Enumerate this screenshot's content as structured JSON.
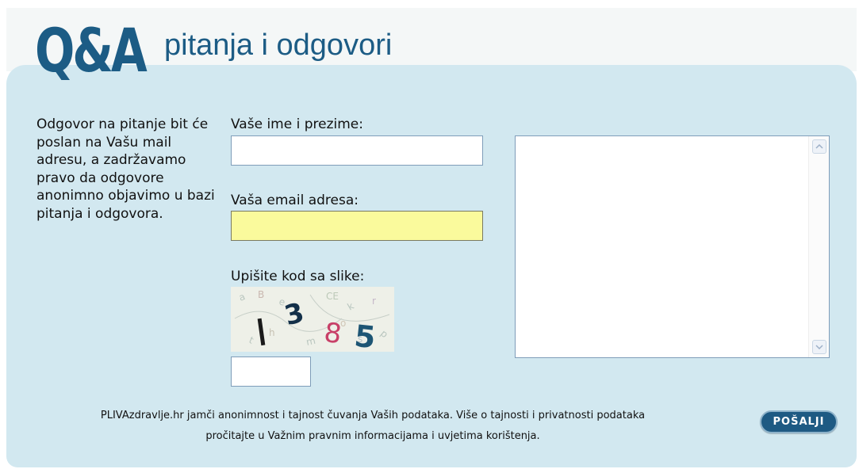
{
  "header": {
    "logo_text": "Q&A",
    "subtitle": "pitanja i odgovori"
  },
  "intro_text": "Odgovor na pitanje bit će poslan na Vašu mail adresu, a zadržavamo pravo da odgovore anonimno objavimo u bazi pitanja i odgovora.",
  "form": {
    "name_label": "Vaše ime i prezime:",
    "name_value": "",
    "email_label": "Vaša email adresa:",
    "email_value": "",
    "captcha_label": "Upišite kod sa slike:",
    "captcha_code": "385",
    "code_value": "",
    "question_value": ""
  },
  "footer": {
    "line1": "PLIVAzdravlje.hr jamči anonimnost i tajnost čuvanja Vaših podataka. Više o tajnosti i privatnosti podataka",
    "line2": "pročitajte u Važnim pravnim informacijama i uvjetima korištenja."
  },
  "send_button_label": "POŠALJI",
  "colors": {
    "panel": "#d2e8f0",
    "brand": "#1c5c85",
    "email_highlight": "#fafa9c",
    "button": "#1e5a83"
  },
  "icons": {
    "scroll_up": "chevron-up-icon",
    "scroll_down": "chevron-down-icon"
  }
}
